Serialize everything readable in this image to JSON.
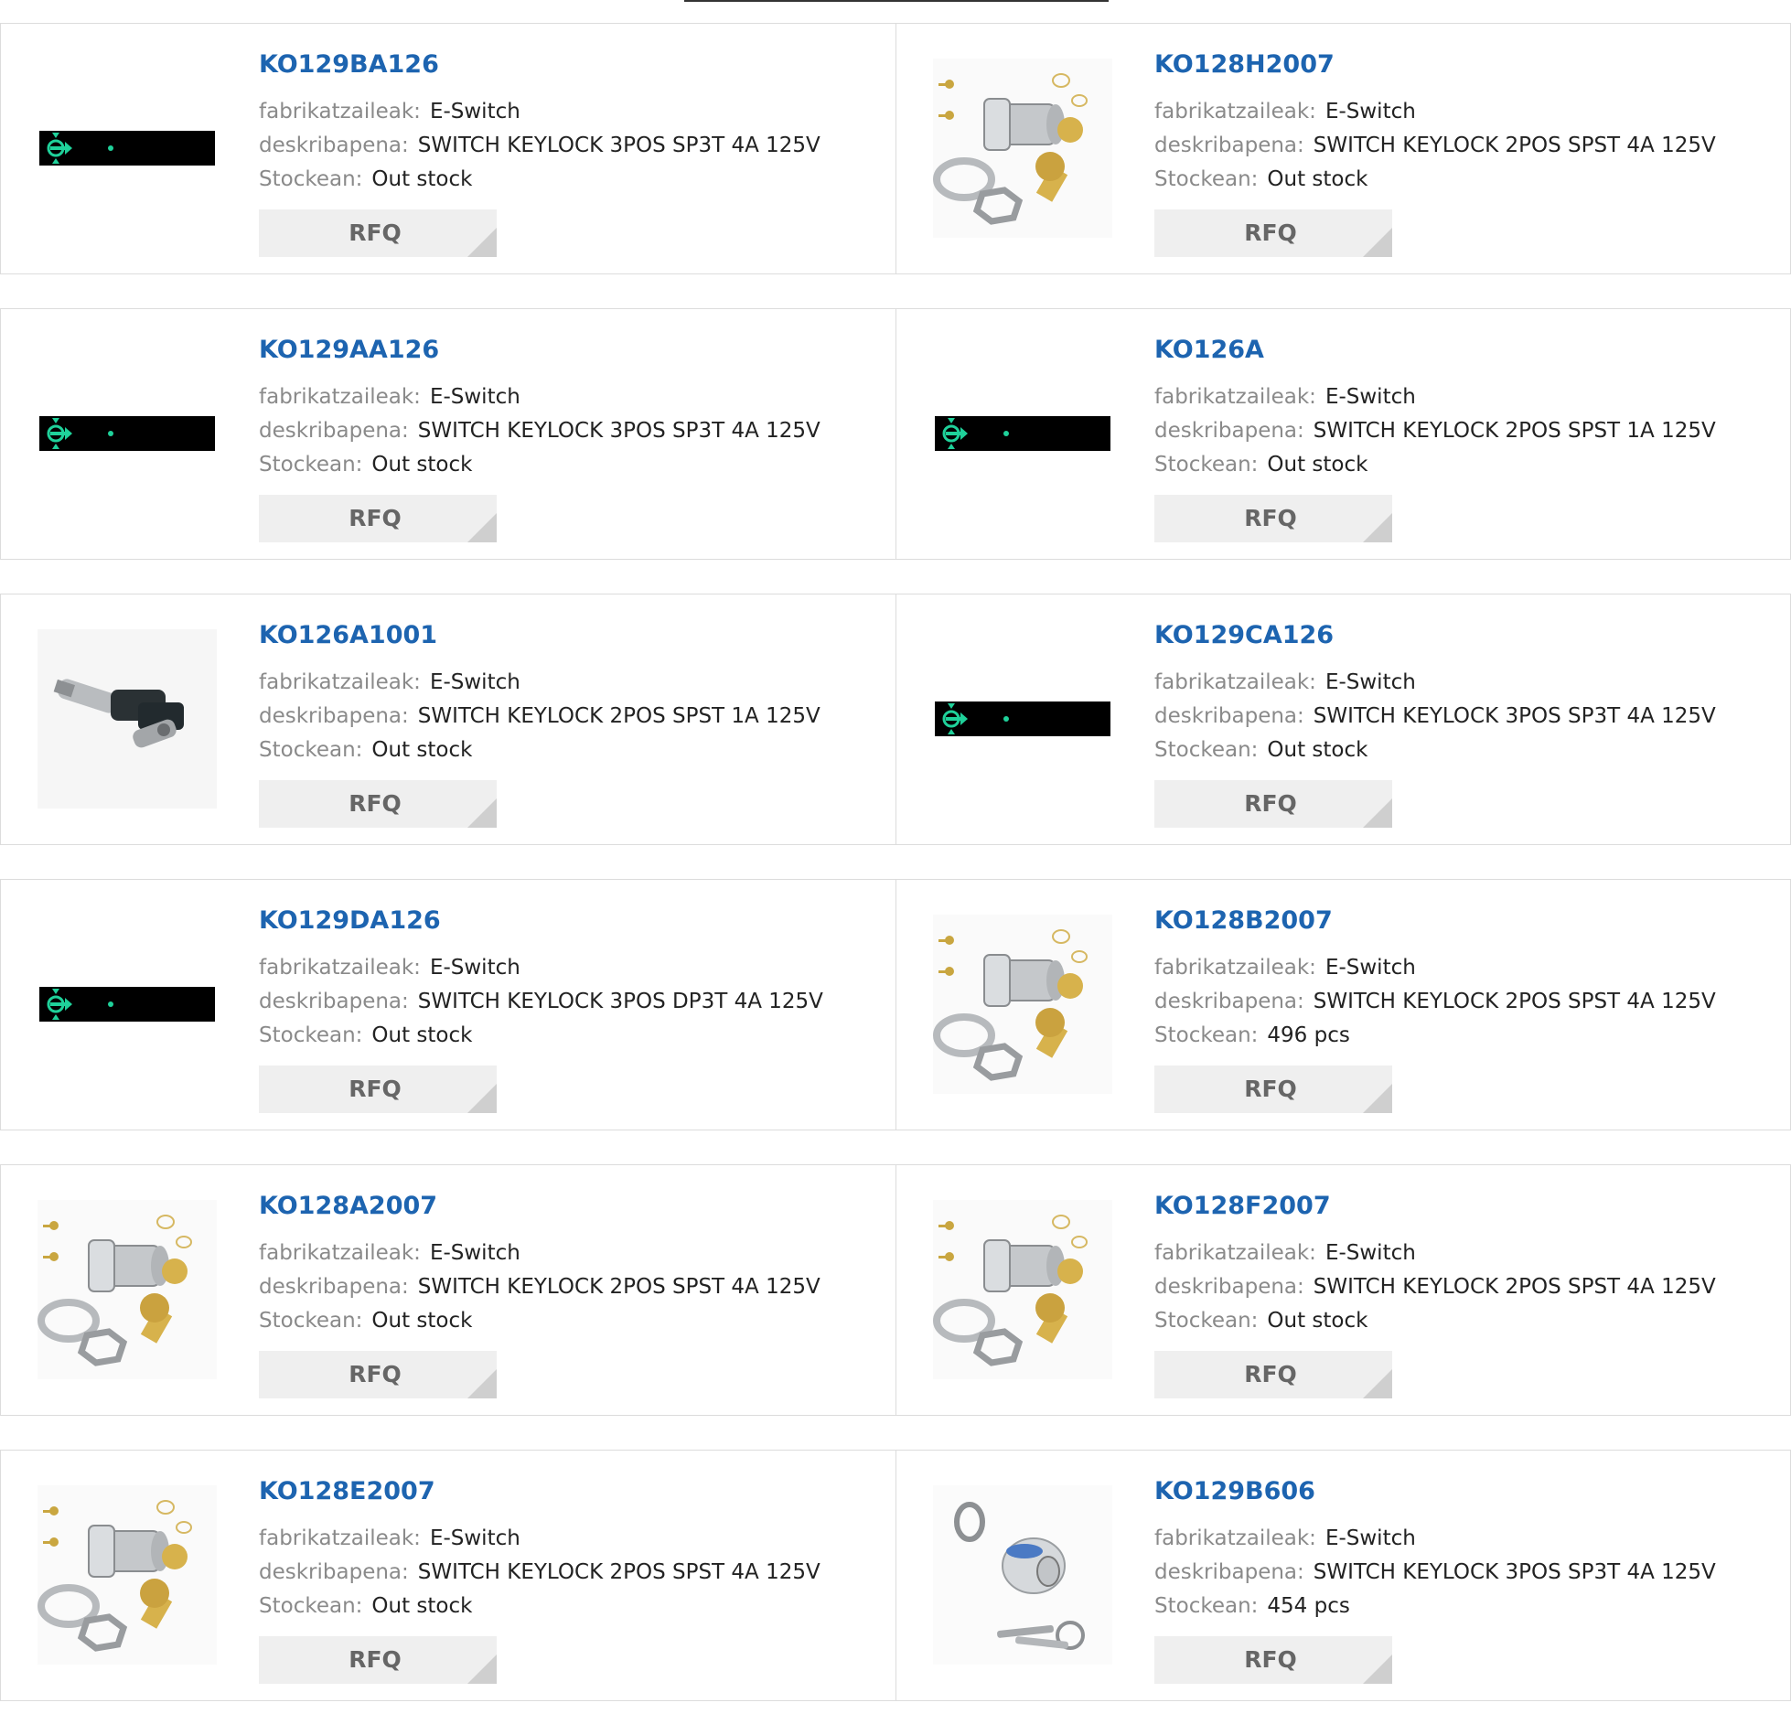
{
  "labels": {
    "manufacturer": "fabrikatzaileak:",
    "description": "deskribapena:",
    "stock": "Stockean:",
    "rfq": "RFQ"
  },
  "colors": {
    "part_link": "#1d64b0",
    "label_gray": "#8a8a8a",
    "rfq_bg": "#efefef",
    "placeholder_bg": "#000000",
    "placeholder_icon": "#1fd19a"
  },
  "products": [
    {
      "part": "KO129BA126",
      "manufacturer": "E-Switch",
      "description": "SWITCH KEYLOCK 3POS SP3T 4A 125V",
      "stock": "Out stock",
      "image": "placeholder"
    },
    {
      "part": "KO128H2007",
      "manufacturer": "E-Switch",
      "description": "SWITCH KEYLOCK 2POS SPST 4A 125V",
      "stock": "Out stock",
      "image": "keylock-kit"
    },
    {
      "part": "KO129AA126",
      "manufacturer": "E-Switch",
      "description": "SWITCH KEYLOCK 3POS SP3T 4A 125V",
      "stock": "Out stock",
      "image": "placeholder"
    },
    {
      "part": "KO126A",
      "manufacturer": "E-Switch",
      "description": "SWITCH KEYLOCK 2POS SPST 1A 125V",
      "stock": "Out stock",
      "image": "placeholder"
    },
    {
      "part": "KO126A1001",
      "manufacturer": "E-Switch",
      "description": "SWITCH KEYLOCK 2POS SPST 1A 125V",
      "stock": "Out stock",
      "image": "tubular-lock"
    },
    {
      "part": "KO129CA126",
      "manufacturer": "E-Switch",
      "description": "SWITCH KEYLOCK 3POS SP3T 4A 125V",
      "stock": "Out stock",
      "image": "placeholder"
    },
    {
      "part": "KO129DA126",
      "manufacturer": "E-Switch",
      "description": "SWITCH KEYLOCK 3POS DP3T 4A 125V",
      "stock": "Out stock",
      "image": "placeholder"
    },
    {
      "part": "KO128B2007",
      "manufacturer": "E-Switch",
      "description": "SWITCH KEYLOCK 2POS SPST 4A 125V",
      "stock": "496 pcs",
      "image": "keylock-kit"
    },
    {
      "part": "KO128A2007",
      "manufacturer": "E-Switch",
      "description": "SWITCH KEYLOCK 2POS SPST 4A 125V",
      "stock": "Out stock",
      "image": "keylock-kit"
    },
    {
      "part": "KO128F2007",
      "manufacturer": "E-Switch",
      "description": "SWITCH KEYLOCK 2POS SPST 4A 125V",
      "stock": "Out stock",
      "image": "keylock-kit"
    },
    {
      "part": "KO128E2007",
      "manufacturer": "E-Switch",
      "description": "SWITCH KEYLOCK 2POS SPST 4A 125V",
      "stock": "Out stock",
      "image": "keylock-kit"
    },
    {
      "part": "KO129B606",
      "manufacturer": "E-Switch",
      "description": "SWITCH KEYLOCK 3POS SP3T 4A 125V",
      "stock": "454 pcs",
      "image": "round-keyswitch"
    }
  ]
}
